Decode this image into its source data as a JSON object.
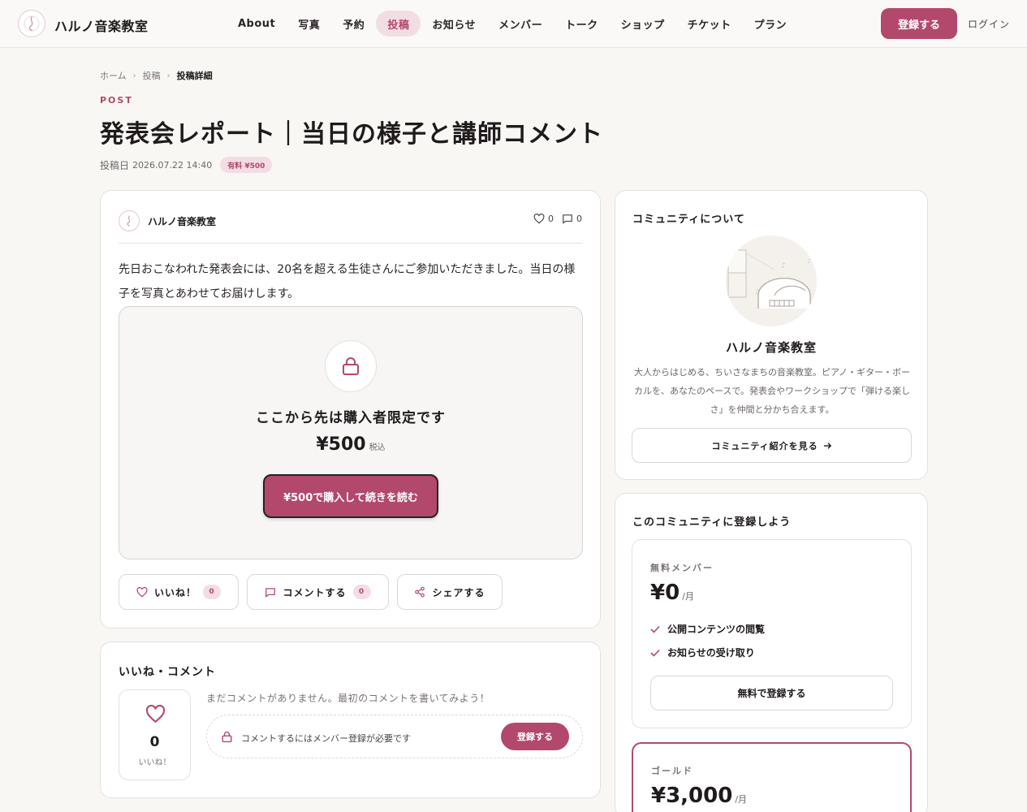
{
  "header": {
    "site_name": "ハルノ音楽教室",
    "nav": [
      {
        "label": "About"
      },
      {
        "label": "写真"
      },
      {
        "label": "予約"
      },
      {
        "label": "投稿",
        "active": true
      },
      {
        "label": "お知らせ"
      },
      {
        "label": "メンバー"
      },
      {
        "label": "トーク"
      },
      {
        "label": "ショップ"
      },
      {
        "label": "チケット"
      },
      {
        "label": "プラン"
      }
    ],
    "register_label": "登録する",
    "login_label": "ログイン"
  },
  "breadcrumb": {
    "home": "ホーム",
    "section": "投稿",
    "current": "投稿詳細"
  },
  "post": {
    "kicker": "POST",
    "title": "発表会レポート｜当日の様子と講師コメント",
    "date_label": "投稿日",
    "date": "2026.07.22 14:40",
    "badge": "有料 ¥500",
    "author": "ハルノ音楽教室",
    "likes": "0",
    "comments": "0",
    "body": "先日おこなわれた発表会には、20名を超える生徒さんにご参加いただきました。当日の様子を写真とあわせてお届けします。",
    "lock_title": "ここから先は購入者限定です",
    "lock_price": "¥500",
    "lock_tax": "税込",
    "buy_label": "¥500で購入して続きを読む",
    "actions": {
      "like_label": "いいね！",
      "like_count": "0",
      "comment_label": "コメントする",
      "comment_count": "0",
      "share_label": "シェアする"
    }
  },
  "comments": {
    "title": "いいね・コメント",
    "like_count": "0",
    "like_label": "いいね！",
    "empty_text": "まだコメントがありません。最初のコメントを書いてみよう！",
    "gate_text": "コメントするにはメンバー登録が必要です",
    "gate_button": "登録する"
  },
  "about": {
    "title": "コミュニティについて",
    "name": "ハルノ音楽教室",
    "description": "大人からはじめる、ちいさなまちの音楽教室。ピアノ・ギター・ボーカルを、あなたのペースで。発表会やワークショップで「弾ける楽しさ」を仲間と分かち合えます。",
    "button_label": "コミュニティ紹介を見る"
  },
  "join": {
    "title": "このコミュニティに登録しよう",
    "free": {
      "label": "無料メンバー",
      "price": "¥0",
      "unit": "/月",
      "features": [
        "公開コンテンツの閲覧",
        "お知らせの受け取り"
      ],
      "button_label": "無料で登録する"
    },
    "gold": {
      "label": "ゴールド",
      "price": "¥3,000",
      "unit": "/月"
    }
  },
  "colors": {
    "accent": "#b3486d",
    "accent_soft": "#f3dde4",
    "background": "#f9f7f4"
  }
}
